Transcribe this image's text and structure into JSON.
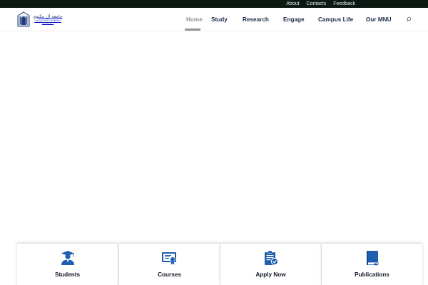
{
  "topbar": {
    "links": [
      "About",
      "Contacts",
      "Feedback"
    ]
  },
  "logo": {
    "arabic": "جامعة آل مكتوم",
    "english_line1": "THE MAKTOUM UNIVERSITY",
    "english_line2": "UNIVERSITY"
  },
  "nav": {
    "items": [
      "Home",
      "Study",
      "Research",
      "Engage",
      "Campus Life",
      "Our MNU"
    ],
    "active": "Home"
  },
  "cards": [
    {
      "label": "Students",
      "icon": "graduate-icon"
    },
    {
      "label": "Courses",
      "icon": "certificate-icon"
    },
    {
      "label": "Apply Now",
      "icon": "clipboard-check-icon"
    },
    {
      "label": "Publications",
      "icon": "book-icon"
    }
  ],
  "colors": {
    "topbar": "#0d1a14",
    "brand_blue": "#1f5fb0",
    "nav_text": "#1a2a4a",
    "nav_active": "#8a9296"
  }
}
